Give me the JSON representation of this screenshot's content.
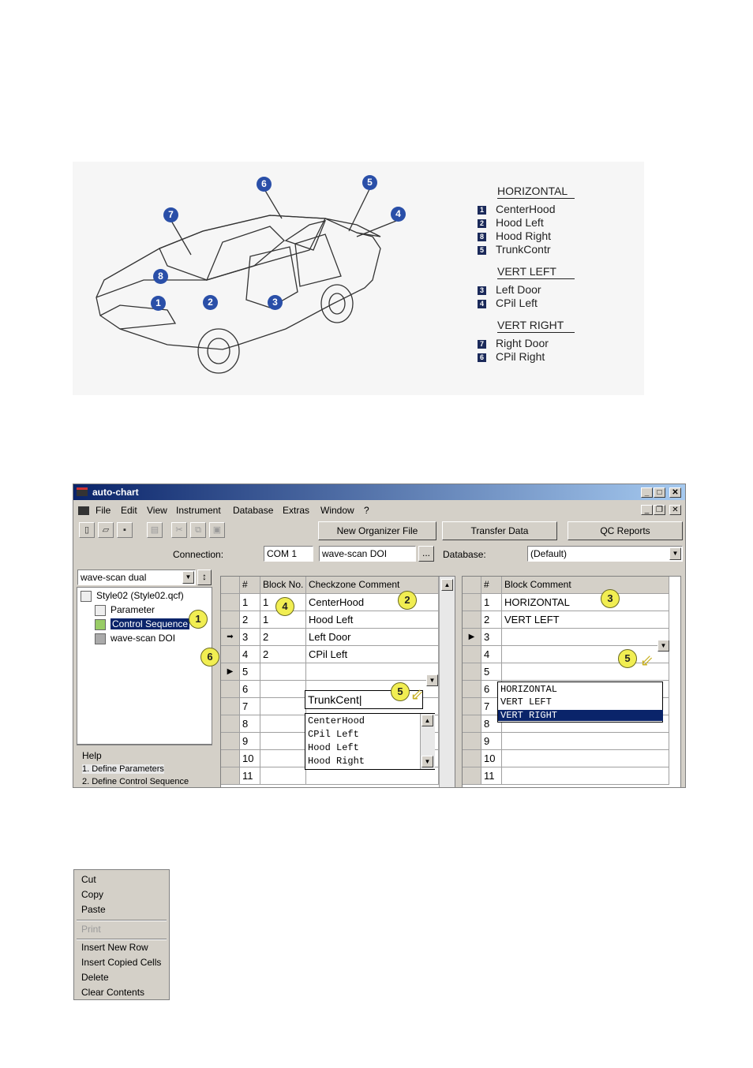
{
  "figure": {
    "markers": [
      "1",
      "2",
      "3",
      "4",
      "5",
      "6",
      "7",
      "8"
    ],
    "legend": [
      {
        "header": "HORIZONTAL",
        "items": [
          {
            "num": "1",
            "label": "CenterHood"
          },
          {
            "num": "2",
            "label": "Hood Left"
          },
          {
            "num": "8",
            "label": "Hood Right"
          },
          {
            "num": "5",
            "label": "TrunkContr"
          }
        ]
      },
      {
        "header": "VERT LEFT",
        "items": [
          {
            "num": "3",
            "label": "Left Door"
          },
          {
            "num": "4",
            "label": "CPil Left"
          }
        ]
      },
      {
        "header": "VERT RIGHT",
        "items": [
          {
            "num": "7",
            "label": "Right Door"
          },
          {
            "num": "6",
            "label": "CPil Right"
          }
        ]
      }
    ]
  },
  "app": {
    "title": "auto-chart",
    "menu": [
      "File",
      "Edit",
      "View",
      "Instrument",
      "Database",
      "Extras",
      "Window",
      "?"
    ],
    "buttons": {
      "new_organizer": "New Organizer File",
      "transfer": "Transfer Data",
      "qc_reports": "QC Reports"
    },
    "connection_label": "Connection:",
    "connection_port": "COM 1",
    "connection_device": "wave-scan DOI",
    "browse": "...",
    "database_label": "Database:",
    "database_value": "(Default)",
    "instrument_select": "wave-scan dual",
    "tree": {
      "root": "Style02  (Style02.qcf)",
      "items": [
        "Parameter",
        "Control Sequence",
        "wave-scan DOI"
      ]
    },
    "help": {
      "title": "Help",
      "items": [
        "1. Define Parameters",
        "2. Define Control Sequence"
      ]
    },
    "grid_left": {
      "headers": [
        "#",
        "Block No.",
        "Checkzone Comment"
      ],
      "rows": [
        [
          "1",
          "1",
          "CenterHood"
        ],
        [
          "2",
          "1",
          "Hood Left"
        ],
        [
          "3",
          "2",
          "Left Door"
        ],
        [
          "4",
          "2",
          "CPil Left"
        ],
        [
          "5",
          "",
          ""
        ],
        [
          "6",
          "",
          ""
        ],
        [
          "7",
          "",
          ""
        ],
        [
          "8",
          "",
          ""
        ],
        [
          "9",
          "",
          ""
        ],
        [
          "10",
          "",
          ""
        ],
        [
          "11",
          "",
          ""
        ]
      ],
      "edit_value": "TrunkCent",
      "dropdown": [
        "CenterHood",
        "CPil Left",
        "Hood Left",
        "Hood Right"
      ]
    },
    "grid_right": {
      "headers": [
        "#",
        "Block Comment"
      ],
      "rows": [
        [
          "1",
          "HORIZONTAL"
        ],
        [
          "2",
          "VERT LEFT"
        ],
        [
          "3",
          ""
        ],
        [
          "4",
          ""
        ],
        [
          "5",
          ""
        ],
        [
          "6",
          ""
        ],
        [
          "7",
          ""
        ],
        [
          "8",
          ""
        ],
        [
          "9",
          ""
        ],
        [
          "10",
          ""
        ],
        [
          "11",
          ""
        ]
      ],
      "dropdown": [
        "HORIZONTAL",
        "VERT LEFT",
        "VERT RIGHT"
      ]
    },
    "callouts": {
      "c1": "1",
      "c2": "2",
      "c3": "3",
      "c4": "4",
      "c5a": "5",
      "c5b": "5",
      "c6": "6"
    }
  },
  "context_menu": {
    "items": [
      "Cut",
      "Copy",
      "Paste",
      "Print",
      "Insert New Row",
      "Insert Copied Cells",
      "Delete",
      "Clear Contents"
    ]
  }
}
